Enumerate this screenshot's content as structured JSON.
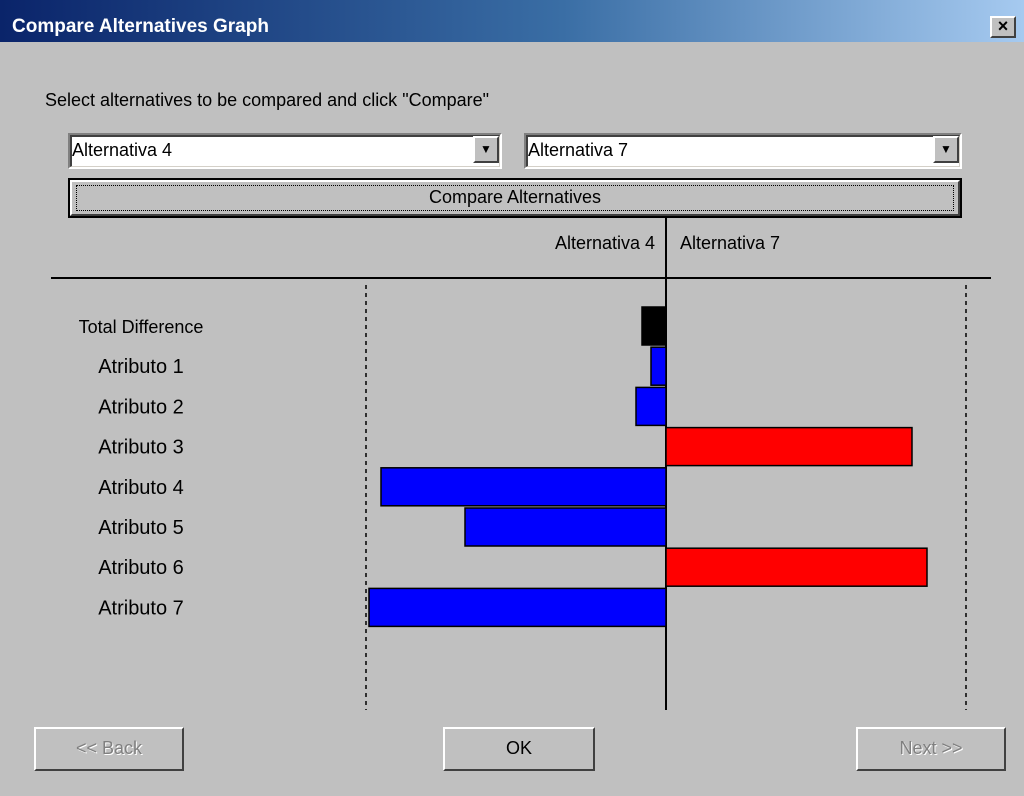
{
  "window": {
    "title": "Compare Alternatives Graph",
    "close_label": "×"
  },
  "instruction": "Select alternatives to be compared and click \"Compare\"",
  "selectors": {
    "left": {
      "value": "Alternativa 4"
    },
    "right": {
      "value": "Alternativa 7"
    }
  },
  "compare_button": {
    "label": "Compare Alternatives"
  },
  "buttons": {
    "back": {
      "label": "<< Back",
      "enabled": false
    },
    "ok": {
      "label": "OK",
      "enabled": true
    },
    "next": {
      "label": "Next >>",
      "enabled": false
    }
  },
  "chart_data": {
    "type": "bar",
    "orientation": "horizontal-diverging",
    "left_header": "Alternativa 4",
    "right_header": "Alternativa 7",
    "categories": [
      "Total Difference",
      "Atributo 1",
      "Atributo 2",
      "Atributo 3",
      "Atributo 4",
      "Atributo 5",
      "Atributo 6",
      "Atributo 7"
    ],
    "values": [
      -0.08,
      -0.05,
      -0.1,
      0.82,
      -0.95,
      -0.67,
      0.87,
      -0.99
    ],
    "xlim": [
      -1,
      1
    ],
    "colors": {
      "total": "#000000",
      "favors_left": "#0000ff",
      "favors_right": "#ff0000"
    },
    "grid": false
  }
}
